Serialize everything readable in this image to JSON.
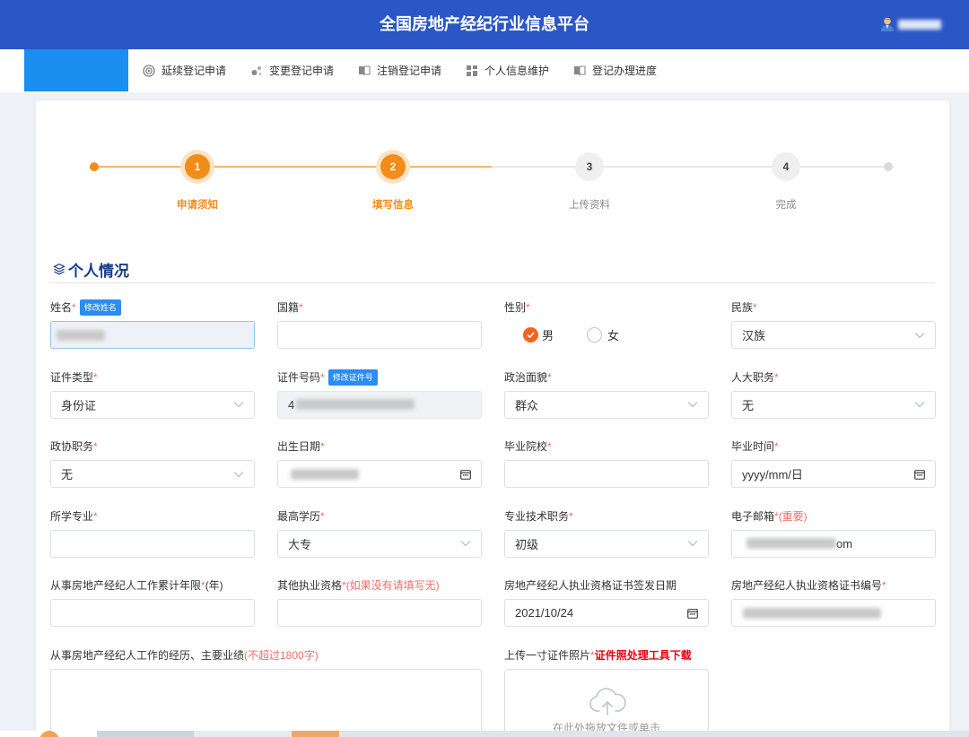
{
  "header": {
    "title": "全国房地产经纪行业信息平台",
    "user_icon": "user-avatar-icon"
  },
  "nav": {
    "items": [
      {
        "label": "延续登记申请",
        "icon": "target-icon"
      },
      {
        "label": "变更登记申请",
        "icon": "dots-icon"
      },
      {
        "label": "注销登记申请",
        "icon": "book-icon"
      },
      {
        "label": "个人信息维护",
        "icon": "grid-icon"
      },
      {
        "label": "登记办理进度",
        "icon": "book-icon"
      }
    ]
  },
  "steps": [
    {
      "number": "1",
      "label": "申请须知",
      "state": "done"
    },
    {
      "number": "2",
      "label": "填写信息",
      "state": "active"
    },
    {
      "number": "3",
      "label": "上传资料",
      "state": "pending"
    },
    {
      "number": "4",
      "label": "完成",
      "state": "pending"
    }
  ],
  "section": {
    "title": "个人情况",
    "icon": "layers-icon"
  },
  "required_mark": "*",
  "form": {
    "name": {
      "label": "姓名",
      "badge": "修改姓名"
    },
    "nationality": {
      "label": "国籍",
      "value": ""
    },
    "gender": {
      "label": "性别",
      "options": [
        "男",
        "女"
      ],
      "selected": "男"
    },
    "ethnicity": {
      "label": "民族",
      "value": "汉族"
    },
    "id_type": {
      "label": "证件类型",
      "value": "身份证"
    },
    "id_number": {
      "label": "证件号码",
      "badge": "修改证件号",
      "value_visible": "4"
    },
    "political_status": {
      "label": "政治面貌",
      "value": "群众"
    },
    "npc_post": {
      "label": "人大职务",
      "value": "无"
    },
    "cppcc_post": {
      "label": "政协职务",
      "value": "无"
    },
    "birth_date": {
      "label": "出生日期"
    },
    "school": {
      "label": "毕业院校",
      "value": ""
    },
    "graduation_date": {
      "label": "毕业时间",
      "value": "yyyy/mm/日"
    },
    "major": {
      "label": "所学专业",
      "value": ""
    },
    "education": {
      "label": "最高学历",
      "value": "大专"
    },
    "tech_title": {
      "label": "专业技术职务",
      "value": "初级"
    },
    "email": {
      "label": "电子邮箱",
      "note": "(重要)",
      "value_visible": "om"
    },
    "years": {
      "label": "从事房地产经纪人工作累计年限",
      "suffix": "(年)",
      "value": ""
    },
    "other_qualification": {
      "label": "其他执业资格",
      "note": "(如果没有请填写无)",
      "value": ""
    },
    "cert_issue_date": {
      "label": "房地产经纪人执业资格证书签发日期",
      "value": "2021/10/24"
    },
    "cert_number": {
      "label": "房地产经纪人执业资格证书编号"
    },
    "experience": {
      "label": "从事房地产经纪人工作的经历、主要业绩",
      "note": "(不超过1800字)",
      "value": ""
    },
    "photo": {
      "label": "上传一寸证件照片",
      "link": "证件照处理工具下载",
      "upload_hint": "在此处拖放文件或单击"
    }
  },
  "colors": {
    "header_bg": "#2b56c5",
    "nav_logo_bg": "#1a8ff0",
    "accent_orange": "#f28c1a",
    "radio_checked": "#f5641e",
    "section_title": "#1b3a8a",
    "required_red": "#f56c6c",
    "link_red": "#e60012",
    "badge_blue": "#2d8cf0"
  },
  "icons": {
    "select": "chevron-down-icon",
    "date": "calendar-icon",
    "upload": "cloud-upload-icon"
  }
}
